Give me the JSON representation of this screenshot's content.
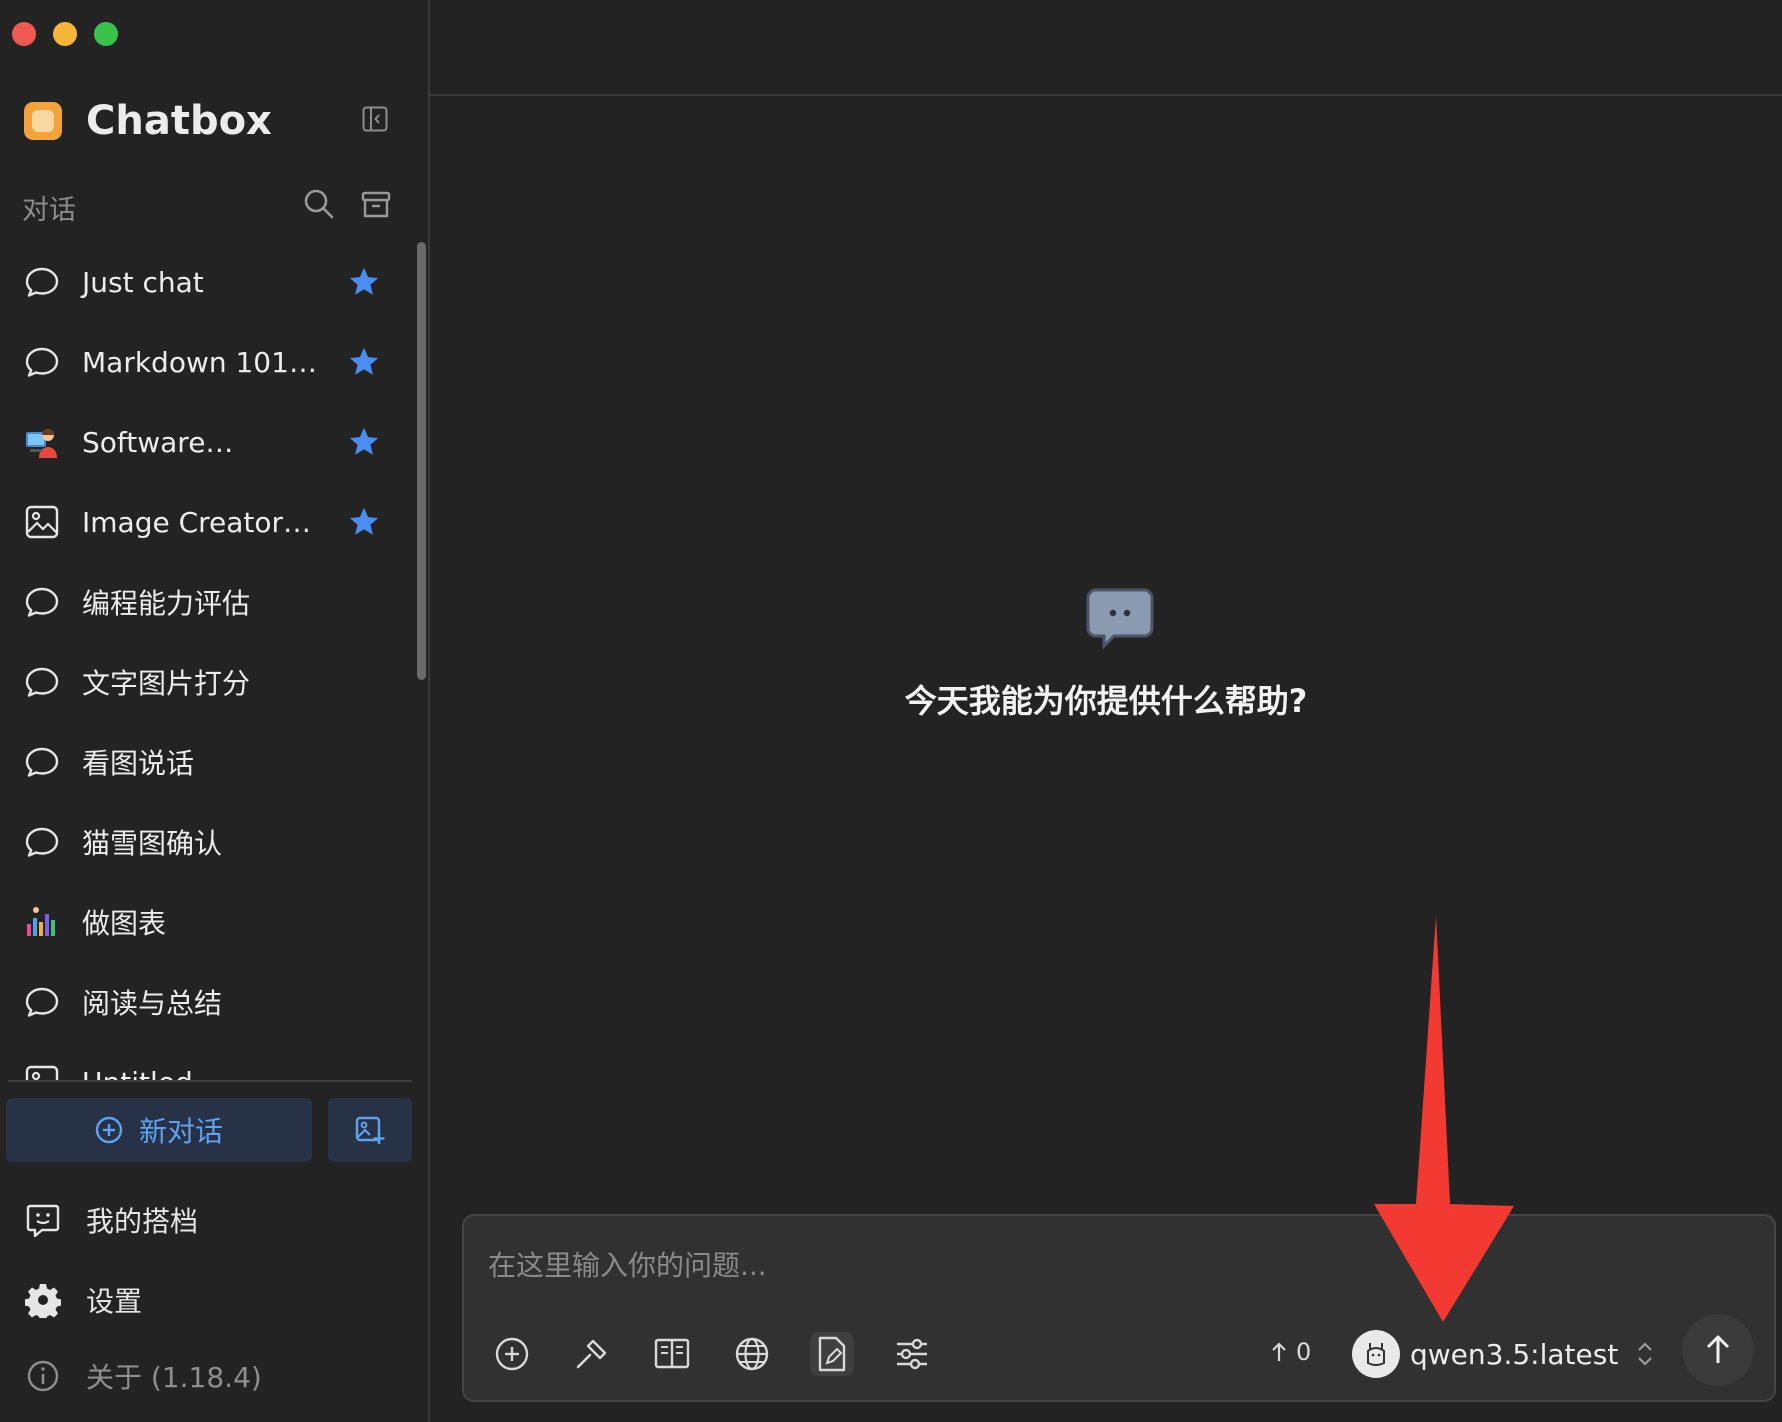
{
  "app": {
    "name": "Chatbox"
  },
  "sidebar": {
    "section_title": "对话",
    "conversations": [
      {
        "label": "Just chat",
        "icon": "chat-bubble-icon",
        "starred": true
      },
      {
        "label": "Markdown 101…",
        "icon": "chat-bubble-icon",
        "starred": true
      },
      {
        "label": "Software…",
        "icon": "developer-avatar-icon",
        "starred": true
      },
      {
        "label": "Image Creator…",
        "icon": "image-icon",
        "starred": true
      },
      {
        "label": "编程能力评估",
        "icon": "chat-bubble-icon",
        "starred": false
      },
      {
        "label": "文字图片打分",
        "icon": "chat-bubble-icon",
        "starred": false
      },
      {
        "label": "看图说话",
        "icon": "chat-bubble-icon",
        "starred": false
      },
      {
        "label": "猫雪图确认",
        "icon": "chat-bubble-icon",
        "starred": false
      },
      {
        "label": "做图表",
        "icon": "chart-avatar-icon",
        "starred": false
      },
      {
        "label": "阅读与总结",
        "icon": "chat-bubble-icon",
        "starred": false
      },
      {
        "label": "Untitled",
        "icon": "image-icon",
        "starred": false
      }
    ],
    "new_chat_label": "新对话",
    "bottom": {
      "partners_label": "我的搭档",
      "settings_label": "设置",
      "about_label": "关于 (1.18.4)"
    }
  },
  "main": {
    "empty_title": "今天我能为你提供什么帮助?"
  },
  "composer": {
    "placeholder": "在这里输入你的问题...",
    "token_count": "0",
    "model_name": "qwen3.5:latest"
  },
  "colors": {
    "accent_blue": "#5ea2f2",
    "star_blue": "#4a8ff0",
    "annotation_red": "#f23a33"
  }
}
